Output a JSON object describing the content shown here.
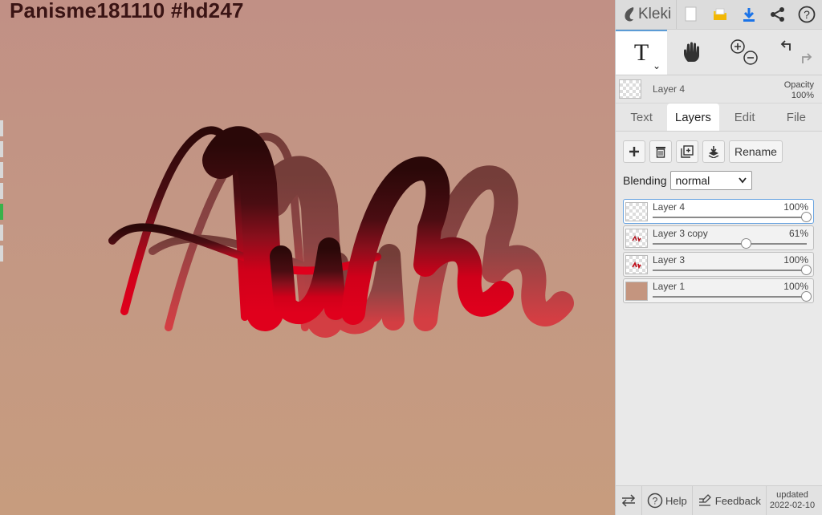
{
  "canvas": {
    "title": "Panisme181110 #hd247",
    "background": "#c4957f"
  },
  "app": {
    "brand_name": "Kleki",
    "accent": "#1a73e8"
  },
  "topbar_icons": [
    "new-document-icon",
    "open-folder-icon",
    "download-icon",
    "share-icon",
    "help-icon"
  ],
  "tools": [
    {
      "name": "text-tool",
      "glyph": "T",
      "active": true
    },
    {
      "name": "hand-tool",
      "active": false
    },
    {
      "name": "zoom-tool",
      "active": false
    },
    {
      "name": "undo-redo",
      "active": false
    }
  ],
  "current_layer": {
    "name": "Layer 4",
    "opacity_label": "Opacity",
    "opacity_value": "100%"
  },
  "tabs": [
    {
      "label": "Text",
      "active": false
    },
    {
      "label": "Layers",
      "active": true
    },
    {
      "label": "Edit",
      "active": false
    },
    {
      "label": "File",
      "active": false
    }
  ],
  "layer_actions": {
    "rename_label": "Rename"
  },
  "blending": {
    "label": "Blending",
    "value": "normal"
  },
  "layers": [
    {
      "name": "Layer 4",
      "opacity": "100%",
      "level": 1.0,
      "selected": true,
      "thumb": "transparent"
    },
    {
      "name": "Layer 3 copy",
      "opacity": "61%",
      "level": 0.61,
      "selected": false,
      "thumb": "lettering"
    },
    {
      "name": "Layer 3",
      "opacity": "100%",
      "level": 1.0,
      "selected": false,
      "thumb": "lettering"
    },
    {
      "name": "Layer 1",
      "opacity": "100%",
      "level": 1.0,
      "selected": false,
      "thumb": "fill"
    }
  ],
  "bottombar": {
    "help_label": "Help",
    "feedback_label": "Feedback",
    "updated_label": "updated",
    "updated_date": "2022-02-10"
  }
}
